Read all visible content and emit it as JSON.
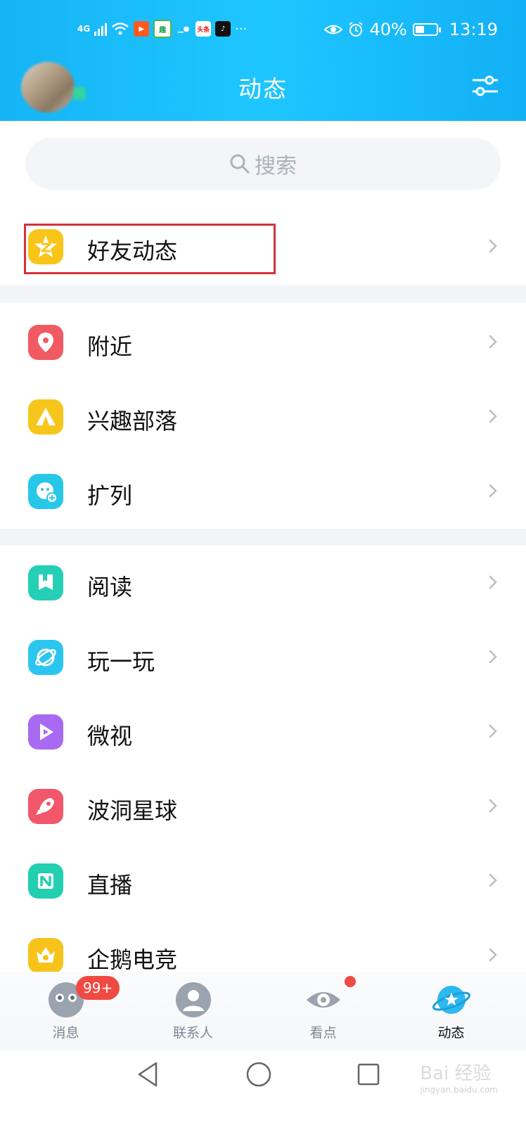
{
  "status_bar": {
    "network": "4G",
    "app_icons": [
      "video-app-icon",
      "reading-app-icon",
      "photo-app-icon",
      "toutiao-app-icon",
      "tiktok-app-icon"
    ],
    "toutiao_label": "头条",
    "overflow": "···",
    "battery": "40%",
    "time": "13:19"
  },
  "header": {
    "title": "动态"
  },
  "search": {
    "placeholder": "搜索"
  },
  "sections": [
    [
      {
        "label": "好友动态",
        "icon": "qzone-star-icon",
        "color": "#f8c518"
      }
    ],
    [
      {
        "label": "附近",
        "icon": "location-pin-icon",
        "color": "#f25a63"
      },
      {
        "label": "兴趣部落",
        "icon": "tent-icon",
        "color": "#f7c61b"
      },
      {
        "label": "扩列",
        "icon": "add-friend-icon",
        "color": "#27c7e8"
      }
    ],
    [
      {
        "label": "阅读",
        "icon": "book-icon",
        "color": "#24cfb5"
      },
      {
        "label": "玩一玩",
        "icon": "planet-icon",
        "color": "#2bc6f0"
      },
      {
        "label": "微视",
        "icon": "play-icon",
        "color": "#a86af0"
      },
      {
        "label": "波洞星球",
        "icon": "rocket-icon",
        "color": "#f2576a"
      },
      {
        "label": "直播",
        "icon": "live-icon",
        "color": "#22cfb0"
      },
      {
        "label": "企鹅电竞",
        "icon": "crown-icon",
        "color": "#f7c31a"
      }
    ]
  ],
  "bottom_nav": {
    "tabs": [
      {
        "label": "消息",
        "icon": "message-icon"
      },
      {
        "label": "联系人",
        "icon": "contacts-icon"
      },
      {
        "label": "看点",
        "icon": "eye-icon"
      },
      {
        "label": "动态",
        "icon": "planet-icon"
      }
    ],
    "message_badge": "99+",
    "active": "动态"
  },
  "watermark": {
    "text": "Bai 经验",
    "sub": "jingyan.baidu.com"
  },
  "colors": {
    "header": "#1ec6ff",
    "highlight": "#d0343a",
    "badge": "#f04a42"
  }
}
